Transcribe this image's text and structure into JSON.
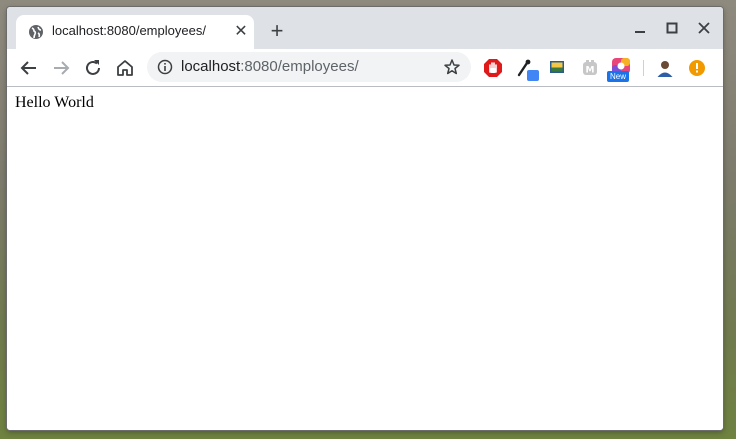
{
  "tab": {
    "title": "localhost:8080/employees/",
    "favicon": "globe-icon",
    "close_glyph": "✕"
  },
  "new_tab_glyph": "+",
  "window_controls": [
    "minimize-icon",
    "maximize-icon",
    "close-icon"
  ],
  "toolbar": {
    "back": "back-arrow-icon",
    "forward": "forward-arrow-icon",
    "reload": "reload-icon",
    "home": "home-icon"
  },
  "omnibox": {
    "url_host": "localhost",
    "url_rest": ":8080/employees/",
    "info_icon": "info-icon",
    "bookmark_icon": "star-icon"
  },
  "extensions": [
    {
      "icon": "adblock-hand-icon"
    },
    {
      "icon": "color-picker-icon"
    },
    {
      "icon": "picture-icon"
    },
    {
      "icon": "m-extension-icon"
    },
    {
      "icon": "colorful-extension-icon",
      "badge": "New"
    }
  ],
  "profile_icon": "avatar-icon",
  "update_icon": "update-alert-icon",
  "colors": {
    "tabstrip": "#dee1e6",
    "omnibox": "#f1f3f4",
    "accent_blue": "#1a73e8",
    "alert_orange": "#f29900",
    "adblock_red": "#e0191b"
  },
  "page": {
    "body_text": "Hello World"
  }
}
